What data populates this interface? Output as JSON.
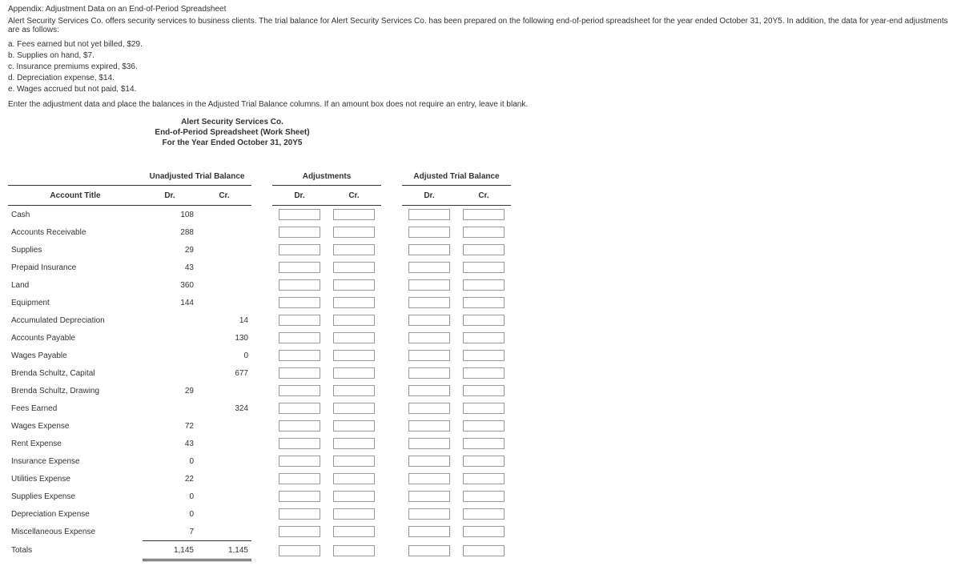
{
  "heading": "Appendix: Adjustment Data on an End-of-Period Spreadsheet",
  "intro": "Alert Security Services Co. offers security services to business clients. The trial balance for Alert Security Services Co. has been prepared on the following end-of-period spreadsheet for the year ended October 31, 20Y5. In addition, the data for year-end adjustments are as follows:",
  "adjustments": [
    "a. Fees earned but not yet billed, $29.",
    "b. Supplies on hand, $7.",
    "c. Insurance premiums expired, $36.",
    "d. Depreciation expense, $14.",
    "e. Wages accrued but not paid, $14."
  ],
  "instruction": "Enter the adjustment data and place the balances in the Adjusted Trial Balance columns.  If an amount box does not require an entry, leave it blank.",
  "sheet_header": {
    "company": "Alert Security Services Co.",
    "title": "End-of-Period Spreadsheet (Work Sheet)",
    "period": "For the Year Ended October 31, 20Y5"
  },
  "col_groups": {
    "account": "Account Title",
    "unadj": "Unadjusted Trial Balance",
    "adj": "Adjustments",
    "adjtb": "Adjusted Trial Balance",
    "dr": "Dr.",
    "cr": "Cr."
  },
  "rows": [
    {
      "title": "Cash",
      "dr": "108",
      "cr": ""
    },
    {
      "title": "Accounts Receivable",
      "dr": "288",
      "cr": ""
    },
    {
      "title": "Supplies",
      "dr": "29",
      "cr": ""
    },
    {
      "title": "Prepaid Insurance",
      "dr": "43",
      "cr": ""
    },
    {
      "title": "Land",
      "dr": "360",
      "cr": ""
    },
    {
      "title": "Equipment",
      "dr": "144",
      "cr": ""
    },
    {
      "title": "Accumulated Depreciation",
      "dr": "",
      "cr": "14"
    },
    {
      "title": "Accounts Payable",
      "dr": "",
      "cr": "130"
    },
    {
      "title": "Wages Payable",
      "dr": "",
      "cr": "0"
    },
    {
      "title": "Brenda Schultz, Capital",
      "dr": "",
      "cr": "677"
    },
    {
      "title": "Brenda Schultz, Drawing",
      "dr": "29",
      "cr": ""
    },
    {
      "title": "Fees Earned",
      "dr": "",
      "cr": "324"
    },
    {
      "title": "Wages Expense",
      "dr": "72",
      "cr": ""
    },
    {
      "title": "Rent Expense",
      "dr": "43",
      "cr": ""
    },
    {
      "title": "Insurance Expense",
      "dr": "0",
      "cr": ""
    },
    {
      "title": "Utilities Expense",
      "dr": "22",
      "cr": ""
    },
    {
      "title": "Supplies Expense",
      "dr": "0",
      "cr": ""
    },
    {
      "title": "Depreciation Expense",
      "dr": "0",
      "cr": ""
    },
    {
      "title": "Miscellaneous Expense",
      "dr": "7",
      "cr": ""
    }
  ],
  "totals": {
    "title": "Totals",
    "dr": "1,145",
    "cr": "1,145"
  }
}
